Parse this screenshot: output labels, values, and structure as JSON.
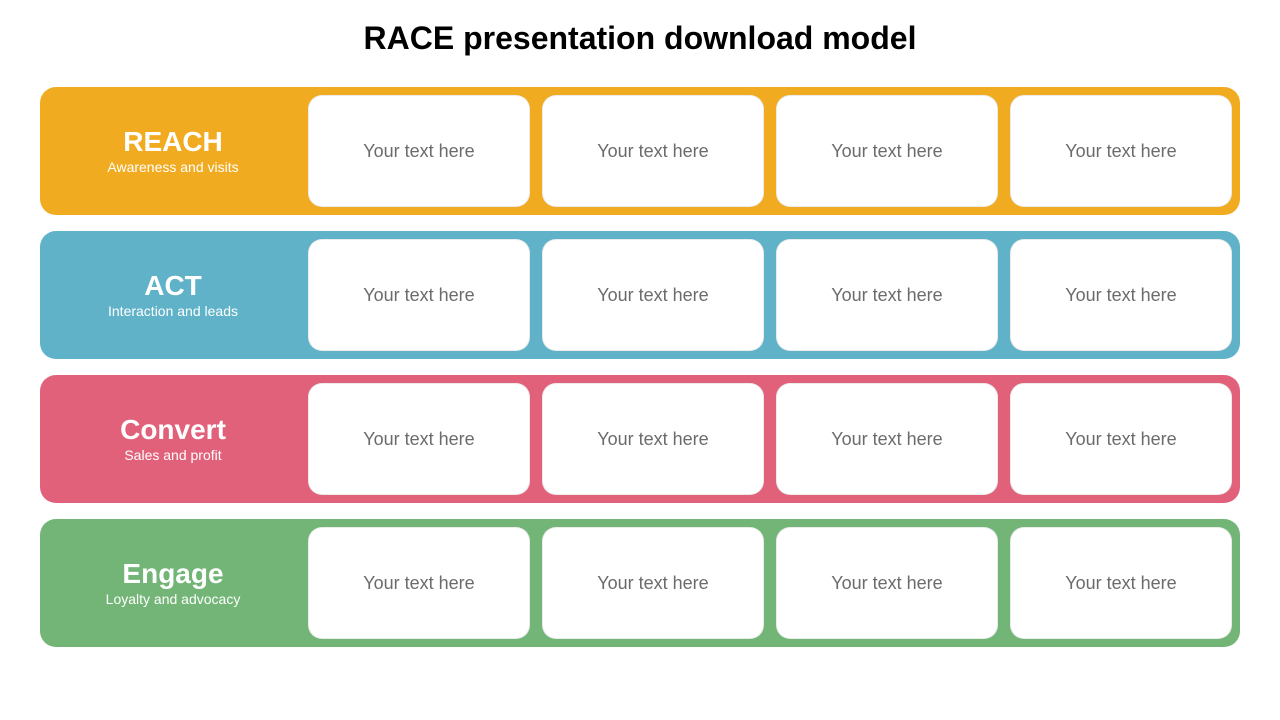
{
  "title": "RACE presentation download model",
  "rows": [
    {
      "label": "REACH",
      "subtitle": "Awareness and visits",
      "color": "#F1AB20",
      "cells": [
        "Your text here",
        "Your text here",
        "Your text here",
        "Your text here"
      ]
    },
    {
      "label": "ACT",
      "subtitle": "Interaction and leads",
      "color": "#5FB2C8",
      "cells": [
        "Your text here",
        "Your text here",
        "Your text here",
        "Your text here"
      ]
    },
    {
      "label": "Convert",
      "subtitle": "Sales and profit",
      "color": "#E2617A",
      "cells": [
        "Your text here",
        "Your text here",
        "Your text here",
        "Your text here"
      ]
    },
    {
      "label": "Engage",
      "subtitle": "Loyalty and advocacy",
      "color": "#72B576",
      "cells": [
        "Your text here",
        "Your text here",
        "Your text here",
        "Your text here"
      ]
    }
  ]
}
